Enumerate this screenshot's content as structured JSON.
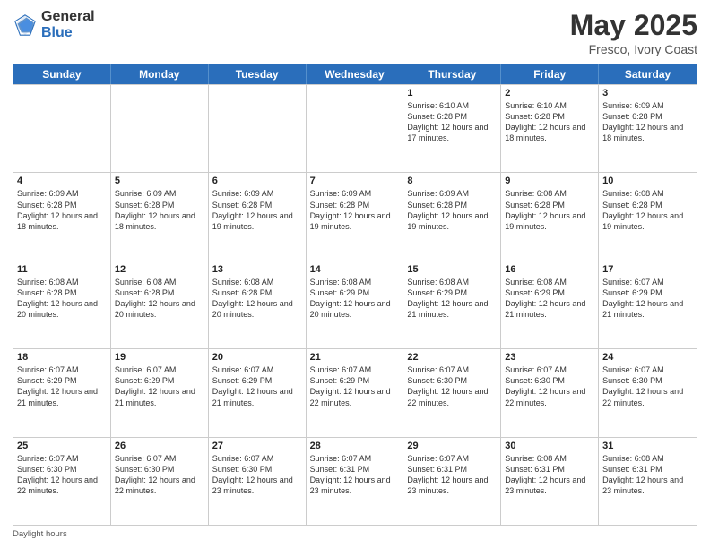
{
  "header": {
    "logo_general": "General",
    "logo_blue": "Blue",
    "title": "May 2025",
    "location": "Fresco, Ivory Coast"
  },
  "calendar": {
    "days_of_week": [
      "Sunday",
      "Monday",
      "Tuesday",
      "Wednesday",
      "Thursday",
      "Friday",
      "Saturday"
    ],
    "weeks": [
      [
        {
          "day": "",
          "info": ""
        },
        {
          "day": "",
          "info": ""
        },
        {
          "day": "",
          "info": ""
        },
        {
          "day": "",
          "info": ""
        },
        {
          "day": "1",
          "info": "Sunrise: 6:10 AM\nSunset: 6:28 PM\nDaylight: 12 hours\nand 17 minutes."
        },
        {
          "day": "2",
          "info": "Sunrise: 6:10 AM\nSunset: 6:28 PM\nDaylight: 12 hours\nand 18 minutes."
        },
        {
          "day": "3",
          "info": "Sunrise: 6:09 AM\nSunset: 6:28 PM\nDaylight: 12 hours\nand 18 minutes."
        }
      ],
      [
        {
          "day": "4",
          "info": "Sunrise: 6:09 AM\nSunset: 6:28 PM\nDaylight: 12 hours\nand 18 minutes."
        },
        {
          "day": "5",
          "info": "Sunrise: 6:09 AM\nSunset: 6:28 PM\nDaylight: 12 hours\nand 18 minutes."
        },
        {
          "day": "6",
          "info": "Sunrise: 6:09 AM\nSunset: 6:28 PM\nDaylight: 12 hours\nand 19 minutes."
        },
        {
          "day": "7",
          "info": "Sunrise: 6:09 AM\nSunset: 6:28 PM\nDaylight: 12 hours\nand 19 minutes."
        },
        {
          "day": "8",
          "info": "Sunrise: 6:09 AM\nSunset: 6:28 PM\nDaylight: 12 hours\nand 19 minutes."
        },
        {
          "day": "9",
          "info": "Sunrise: 6:08 AM\nSunset: 6:28 PM\nDaylight: 12 hours\nand 19 minutes."
        },
        {
          "day": "10",
          "info": "Sunrise: 6:08 AM\nSunset: 6:28 PM\nDaylight: 12 hours\nand 19 minutes."
        }
      ],
      [
        {
          "day": "11",
          "info": "Sunrise: 6:08 AM\nSunset: 6:28 PM\nDaylight: 12 hours\nand 20 minutes."
        },
        {
          "day": "12",
          "info": "Sunrise: 6:08 AM\nSunset: 6:28 PM\nDaylight: 12 hours\nand 20 minutes."
        },
        {
          "day": "13",
          "info": "Sunrise: 6:08 AM\nSunset: 6:28 PM\nDaylight: 12 hours\nand 20 minutes."
        },
        {
          "day": "14",
          "info": "Sunrise: 6:08 AM\nSunset: 6:29 PM\nDaylight: 12 hours\nand 20 minutes."
        },
        {
          "day": "15",
          "info": "Sunrise: 6:08 AM\nSunset: 6:29 PM\nDaylight: 12 hours\nand 21 minutes."
        },
        {
          "day": "16",
          "info": "Sunrise: 6:08 AM\nSunset: 6:29 PM\nDaylight: 12 hours\nand 21 minutes."
        },
        {
          "day": "17",
          "info": "Sunrise: 6:07 AM\nSunset: 6:29 PM\nDaylight: 12 hours\nand 21 minutes."
        }
      ],
      [
        {
          "day": "18",
          "info": "Sunrise: 6:07 AM\nSunset: 6:29 PM\nDaylight: 12 hours\nand 21 minutes."
        },
        {
          "day": "19",
          "info": "Sunrise: 6:07 AM\nSunset: 6:29 PM\nDaylight: 12 hours\nand 21 minutes."
        },
        {
          "day": "20",
          "info": "Sunrise: 6:07 AM\nSunset: 6:29 PM\nDaylight: 12 hours\nand 21 minutes."
        },
        {
          "day": "21",
          "info": "Sunrise: 6:07 AM\nSunset: 6:29 PM\nDaylight: 12 hours\nand 22 minutes."
        },
        {
          "day": "22",
          "info": "Sunrise: 6:07 AM\nSunset: 6:30 PM\nDaylight: 12 hours\nand 22 minutes."
        },
        {
          "day": "23",
          "info": "Sunrise: 6:07 AM\nSunset: 6:30 PM\nDaylight: 12 hours\nand 22 minutes."
        },
        {
          "day": "24",
          "info": "Sunrise: 6:07 AM\nSunset: 6:30 PM\nDaylight: 12 hours\nand 22 minutes."
        }
      ],
      [
        {
          "day": "25",
          "info": "Sunrise: 6:07 AM\nSunset: 6:30 PM\nDaylight: 12 hours\nand 22 minutes."
        },
        {
          "day": "26",
          "info": "Sunrise: 6:07 AM\nSunset: 6:30 PM\nDaylight: 12 hours\nand 22 minutes."
        },
        {
          "day": "27",
          "info": "Sunrise: 6:07 AM\nSunset: 6:30 PM\nDaylight: 12 hours\nand 23 minutes."
        },
        {
          "day": "28",
          "info": "Sunrise: 6:07 AM\nSunset: 6:31 PM\nDaylight: 12 hours\nand 23 minutes."
        },
        {
          "day": "29",
          "info": "Sunrise: 6:07 AM\nSunset: 6:31 PM\nDaylight: 12 hours\nand 23 minutes."
        },
        {
          "day": "30",
          "info": "Sunrise: 6:08 AM\nSunset: 6:31 PM\nDaylight: 12 hours\nand 23 minutes."
        },
        {
          "day": "31",
          "info": "Sunrise: 6:08 AM\nSunset: 6:31 PM\nDaylight: 12 hours\nand 23 minutes."
        }
      ]
    ]
  },
  "footer": {
    "note": "Daylight hours"
  }
}
